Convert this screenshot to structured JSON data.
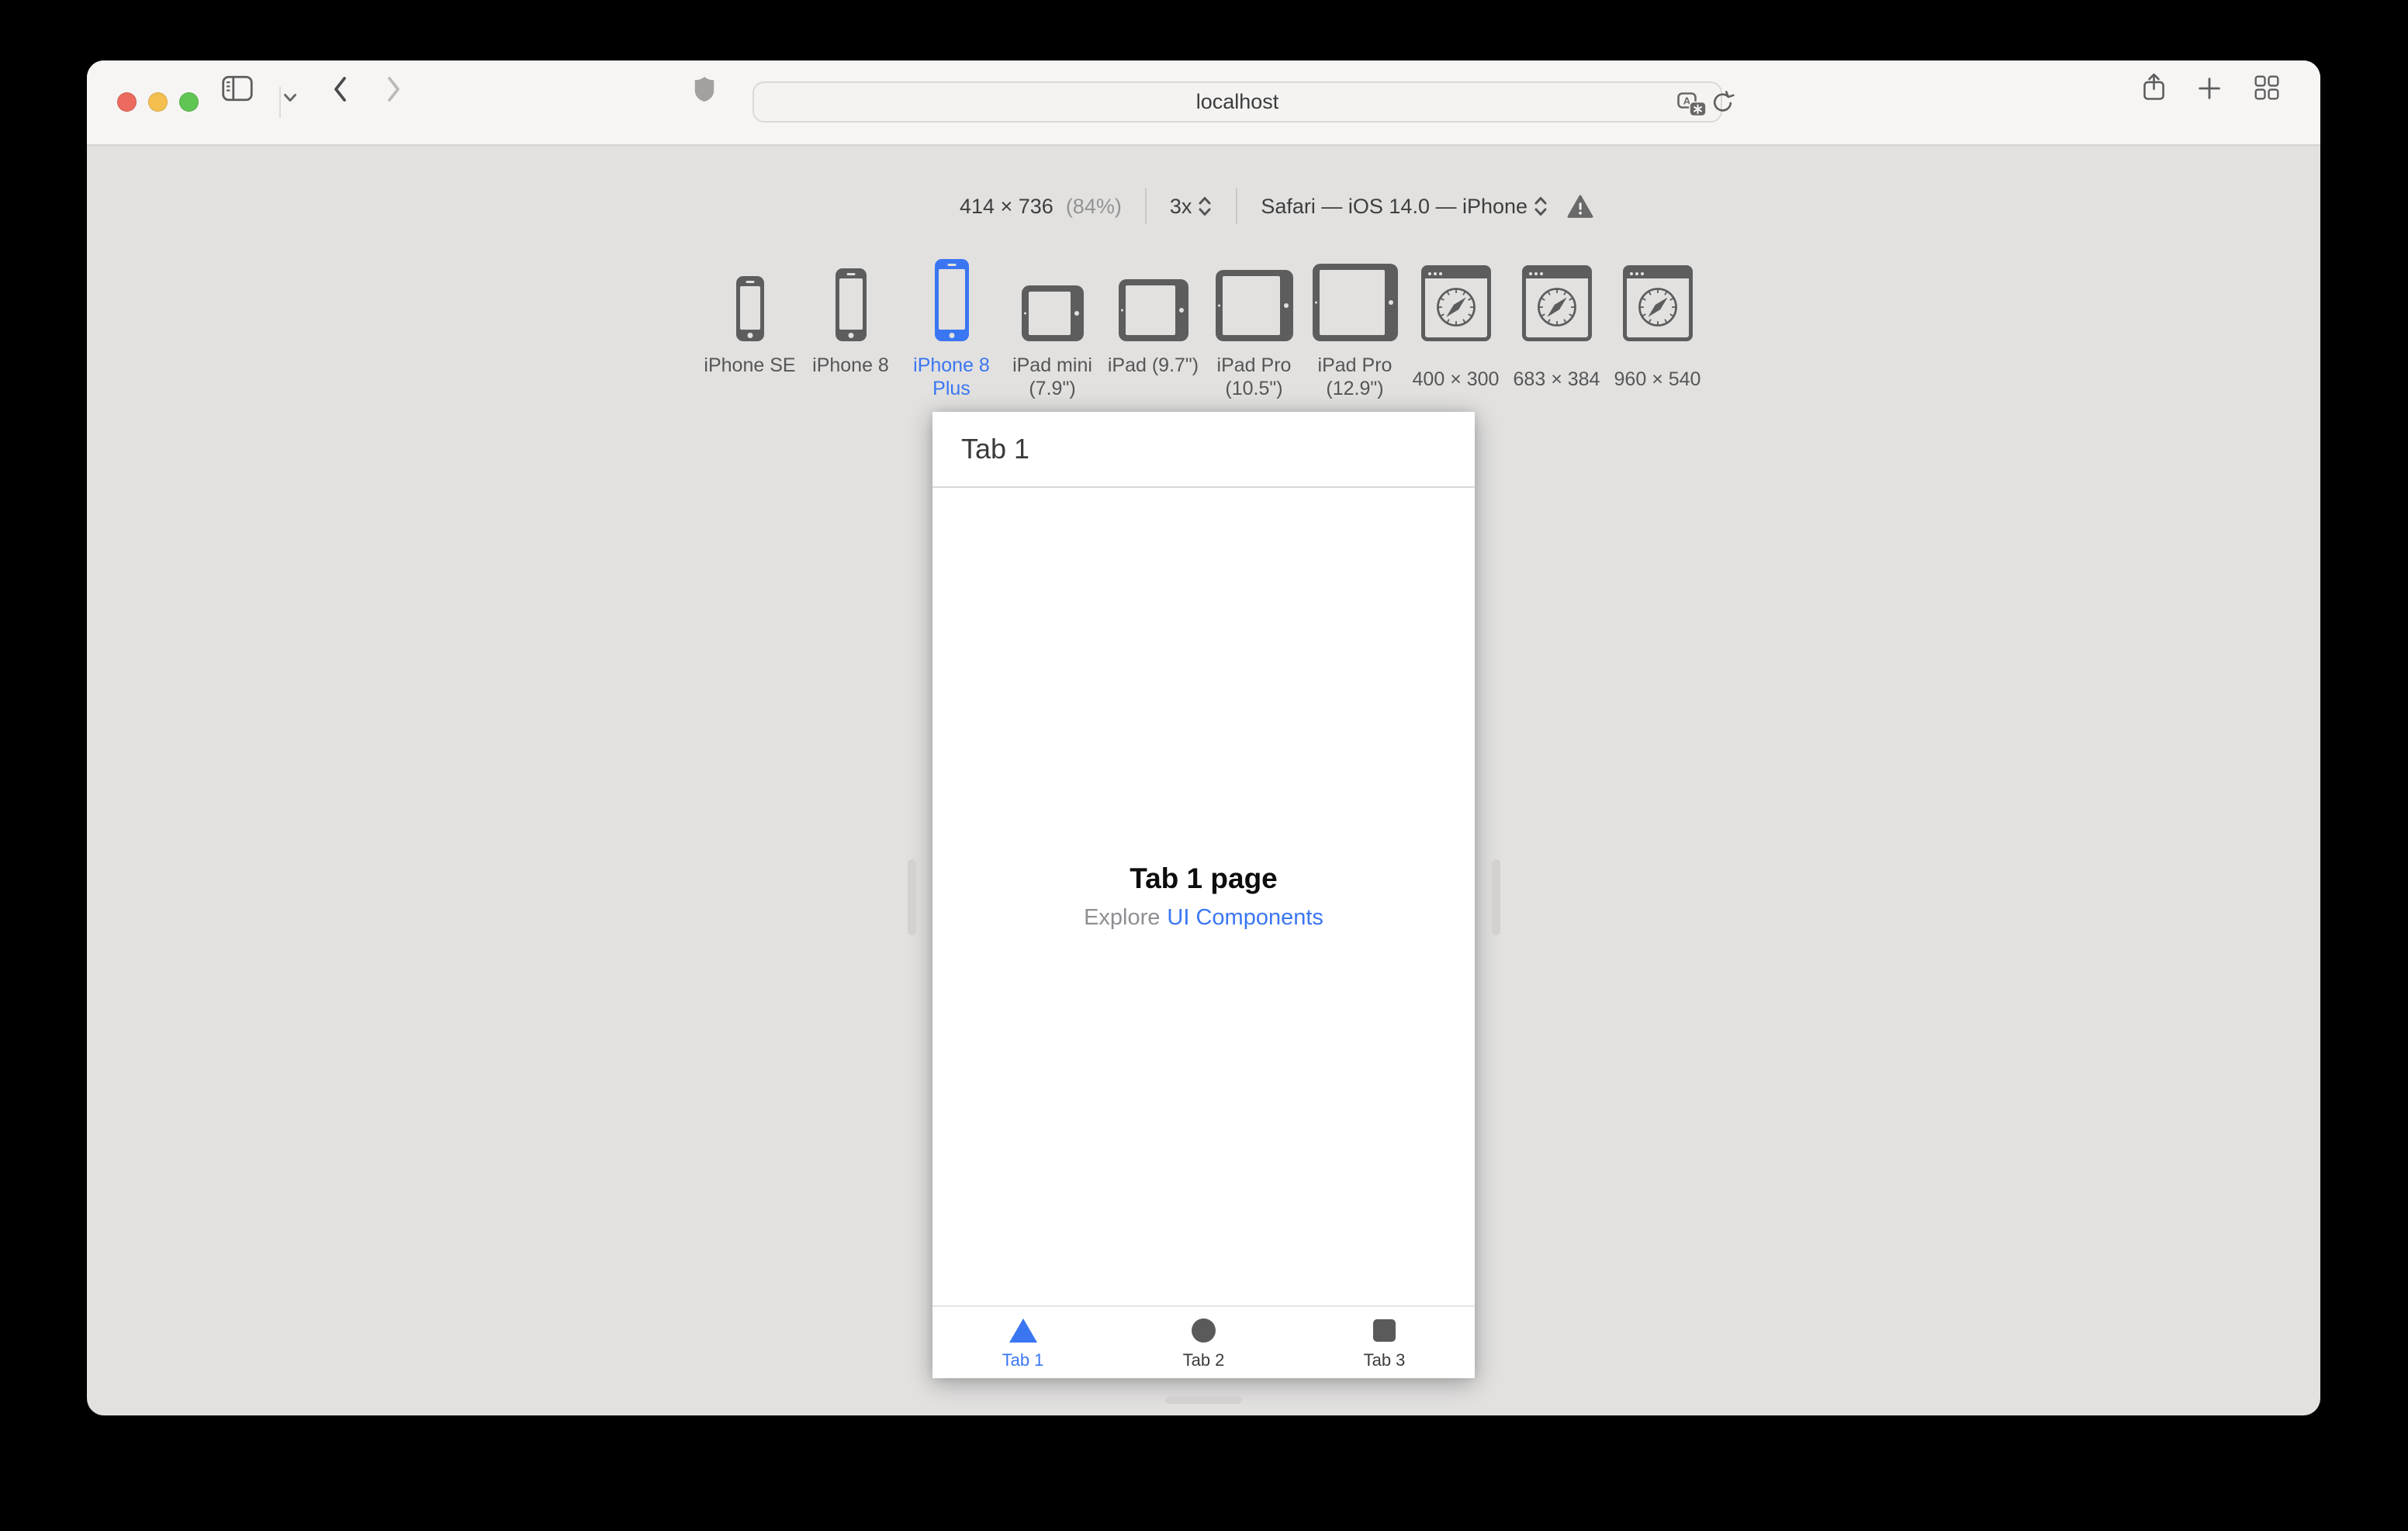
{
  "titlebar": {
    "traffic_lights": [
      "close",
      "minimize",
      "fullscreen"
    ],
    "url_value": "localhost"
  },
  "rdm": {
    "size_label": "414 × 736",
    "zoom_label": "(84%)",
    "scale_label": "3x",
    "ua_label": "Safari — iOS 14.0 — iPhone"
  },
  "devices": [
    {
      "label": "iPhone SE",
      "selected": false
    },
    {
      "label": "iPhone 8",
      "selected": false
    },
    {
      "label": "iPhone 8 Plus",
      "selected": true
    },
    {
      "label": "iPad mini (7.9\")",
      "selected": false
    },
    {
      "label": "iPad (9.7\")",
      "selected": false
    },
    {
      "label": "iPad Pro (10.5\")",
      "selected": false
    },
    {
      "label": "iPad Pro (12.9\")",
      "selected": false
    },
    {
      "label": "400 × 300",
      "selected": false
    },
    {
      "label": "683 × 384",
      "selected": false
    },
    {
      "label": "960 × 540",
      "selected": false
    }
  ],
  "page": {
    "nav_title": "Tab 1",
    "title": "Tab 1 page",
    "subtitle_prefix": "Explore",
    "subtitle_link": "UI Components",
    "tabs": [
      {
        "label": "Tab 1",
        "icon": "triangle",
        "active": true
      },
      {
        "label": "Tab 2",
        "icon": "circle",
        "active": false
      },
      {
        "label": "Tab 3",
        "icon": "square",
        "active": false
      }
    ]
  },
  "colors": {
    "accent_blue": "#3a76f2",
    "traffic_red": "#ec6a5e",
    "traffic_yellow": "#f4bf4f",
    "traffic_green": "#61c554",
    "window_chrome": "#f6f5f4",
    "content_bg": "#e2e1e0"
  }
}
